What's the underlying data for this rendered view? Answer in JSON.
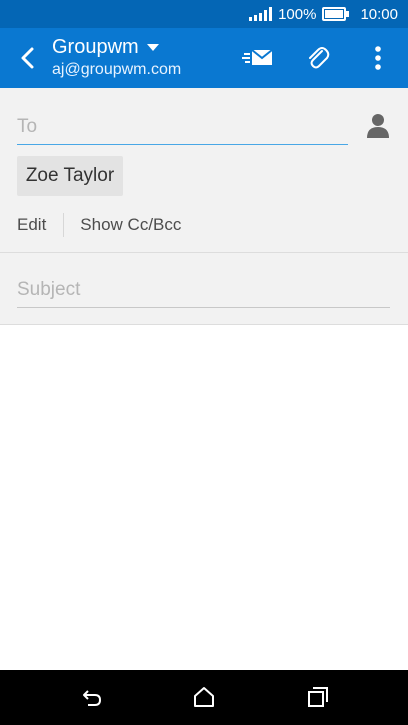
{
  "status_bar": {
    "signal_icon": "signal-bars-icon",
    "battery_percent": "100%",
    "battery_icon": "battery-icon",
    "time": "10:00"
  },
  "app_bar": {
    "back_icon": "back-arrow-icon",
    "account_name": "Groupwm",
    "account_dropdown_icon": "caret-down-icon",
    "account_email": "aj@groupwm.com",
    "send_icon": "send-mail-icon",
    "attach_icon": "paperclip-icon",
    "overflow_icon": "more-vert-icon",
    "color": "#0a78d1",
    "status_color": "#0466b5"
  },
  "compose": {
    "to_placeholder": "To",
    "contact_picker_icon": "person-icon",
    "recipient_chip": "Zoe Taylor",
    "edit_label": "Edit",
    "show_cc_bcc_label": "Show Cc/Bcc",
    "subject_placeholder": "Subject",
    "accent_color": "#49a7e6"
  },
  "nav_bar": {
    "back_icon": "nav-back-icon",
    "home_icon": "nav-home-icon",
    "recents_icon": "nav-recents-icon"
  }
}
